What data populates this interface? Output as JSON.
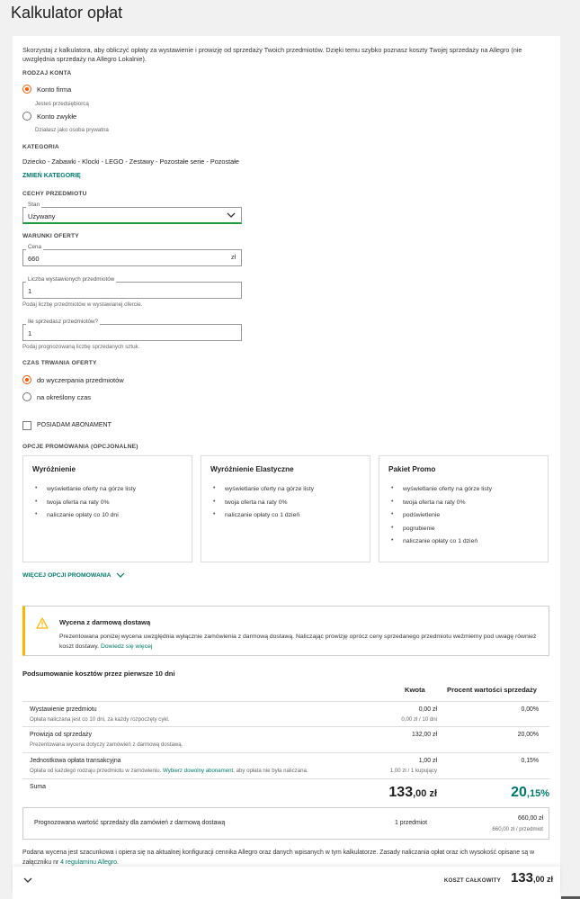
{
  "page": {
    "title": "Kalkulator opłat"
  },
  "intro": "Skorzystaj z kalkulatora, aby obliczyć opłaty za wystawienie i prowizję od sprzedaży Twoich przedmiotów. Dzięki temu szybko poznasz koszty Twojej sprzedaży na Allegro (nie uwzględnia sprzedaży na Allegro Lokalnie).",
  "account": {
    "heading": "RODZAJ KONTA",
    "options": [
      {
        "label": "Konto firma",
        "hint": "Jesteś przedsiębiorcą",
        "selected": true
      },
      {
        "label": "Konto zwykłe",
        "hint": "Działasz jako osoba prywatna",
        "selected": false
      }
    ]
  },
  "category": {
    "heading": "KATEGORIA",
    "path": "Dziecko - Zabawki - Klocki - LEGO - Zestawy - Pozostałe serie - Pozostałe",
    "change_label": "ZMIEŃ KATEGORIĘ"
  },
  "features": {
    "heading": "CECHY PRZEDMIOTU",
    "state_label": "Stan",
    "state_value": "Używany"
  },
  "offer": {
    "heading": "WARUNKI OFERTY",
    "price_label": "Cena",
    "price_value": "660",
    "price_suffix": "zł",
    "count_label": "Liczba wystawionych przedmiotów",
    "count_value": "1",
    "count_hint": "Podaj liczbę przedmiotów w wystawianej ofercie.",
    "sell_label": "Ile sprzedasz przedmiotów?",
    "sell_value": "1",
    "sell_hint": "Podaj prognozowaną liczbę sprzedanych sztuk."
  },
  "duration": {
    "heading": "CZAS TRWANIA OFERTY",
    "options": [
      {
        "label": "do wyczerpania przedmiotów",
        "selected": true
      },
      {
        "label": "na określony czas",
        "selected": false
      }
    ]
  },
  "subscription": {
    "label": "POSIADAM ABONAMENT",
    "checked": false
  },
  "promo": {
    "heading": "OPCJE PROMOWANIA (OPCJONALNE)",
    "cards": [
      {
        "title": "Wyróżnienie",
        "items": [
          "wyświetlanie oferty na górze listy",
          "twoja oferta na raty 0%",
          "naliczanie opłaty co 10 dni"
        ]
      },
      {
        "title": "Wyróżnienie Elastyczne",
        "items": [
          "wyświetlanie oferty na górze listy",
          "twoja oferta na raty 0%",
          "naliczanie opłaty co 1 dzień"
        ]
      },
      {
        "title": "Pakiet Promo",
        "items": [
          "wyświetlanie oferty na górze listy",
          "twoja oferta na raty 0%",
          "podświetlenie",
          "pogrubienie",
          "naliczanie opłaty co 1 dzień"
        ]
      }
    ],
    "more_label": "WIĘCEJ OPCJI PROMOWANIA"
  },
  "warning": {
    "title": "Wycena z darmową dostawą",
    "body": "Prezentowana poniżej wycena uwzględnia wyłącznie zamówienia z darmową dostawą. Naliczając prowizję oprócz ceny sprzedanego przedmiotu weźmiemy pod uwagę również koszt dostawy.",
    "link": "Dowiedz się więcej"
  },
  "summary": {
    "title": "Podsumowanie kosztów przez pierwsze 10 dni",
    "col_amount": "Kwota",
    "col_percent": "Procent wartości sprzedaży",
    "rows": [
      {
        "name": "Wystawienie przedmiotu",
        "desc": "Opłata naliczana jest co 10 dni, za każdy rozpoczęty cykl.",
        "amount": "0,00 zł",
        "amount_sub": "0,00 zł / 10 dni",
        "percent": "0,00%"
      },
      {
        "name": "Prowizja od sprzedaży",
        "desc": "Prezentowana wycena dotyczy zamówień z darmową dostawą.",
        "amount": "132,00 zł",
        "amount_sub": "",
        "percent": "20,00%"
      },
      {
        "name": "Jednostkowa opłata transakcyjna",
        "desc_pre": "Opłata od każdego rodzaju przedmiotu w zamówieniu. ",
        "desc_link": "Wybierz dowolny abonament",
        "desc_post": ", aby opłata nie była naliczana.",
        "amount": "1,00 zł",
        "amount_sub": "1,00 zł / 1 kupujący",
        "percent": "0,15%"
      }
    ],
    "total_label": "Suma",
    "total_amount_int": "133",
    "total_amount_dec": ",00 zł",
    "total_percent_int": "20",
    "total_percent_dec": ",15%"
  },
  "forecast": {
    "label": "Prognozowana wartość sprzedaży dla zamówień z darmową dostawą",
    "qty": "1 przedmiot",
    "value": "660,00 zł",
    "value_sub": "660,00 zł / przedmiot"
  },
  "note": {
    "text": "Podana wycena jest szacunkowa i opiera się na aktualnej konfiguracji cennika Allegro oraz danych wpisanych w tym kalkulatorze. Zasady naliczania opłat oraz ich wysokość opisane są w załączniku nr ",
    "link": "4 regulaminu Allegro",
    "end": "."
  },
  "footer": {
    "label": "KOSZT CAŁKOWITY",
    "value_int": "133",
    "value_dec": ",00 zł"
  },
  "colors": {
    "accent": "#ff5a00",
    "link": "#00796b",
    "valid": "#1a9d3a",
    "warning": "#ffb400"
  }
}
